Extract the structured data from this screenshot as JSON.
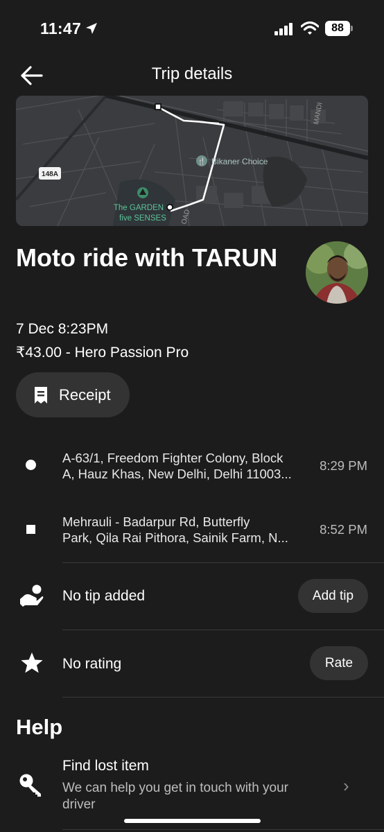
{
  "status_bar": {
    "time": "11:47",
    "battery": "88"
  },
  "header": {
    "title": "Trip details"
  },
  "map": {
    "road_label": "148A",
    "poi_restaurant": "Bikaner Choice",
    "poi_park_line1": "The GARDEN",
    "poi_park_line2": "five SENSES",
    "street_label_1": "MANDI",
    "street_label_2": "OAD"
  },
  "trip": {
    "title": "Moto ride with TARUN",
    "datetime": "7 Dec 8:23PM",
    "price_vehicle": "₹43.00 - Hero Passion Pro",
    "receipt_label": "Receipt"
  },
  "stops": [
    {
      "address_line1": "A-63/1, Freedom Fighter Colony, Block",
      "address_line2": "A, Hauz Khas, New Delhi, Delhi 11003...",
      "time": "8:29 PM"
    },
    {
      "address_line1": "Mehrauli - Badarpur Rd, Butterfly",
      "address_line2": "Park, Qila Rai Pithora, Sainik Farm, N...",
      "time": "8:52 PM"
    }
  ],
  "tip": {
    "label": "No tip added",
    "button": "Add tip"
  },
  "rating": {
    "label": "No rating",
    "button": "Rate"
  },
  "help": {
    "heading": "Help",
    "lost_item_title": "Find lost item",
    "lost_item_subtitle": "We can help you get in touch with your driver"
  },
  "icons": {
    "back": "arrow-left-icon",
    "receipt": "receipt-icon",
    "tip": "hand-coin-icon",
    "rating": "star-icon",
    "lost_item": "key-icon",
    "chevron": "chevron-right-icon"
  }
}
